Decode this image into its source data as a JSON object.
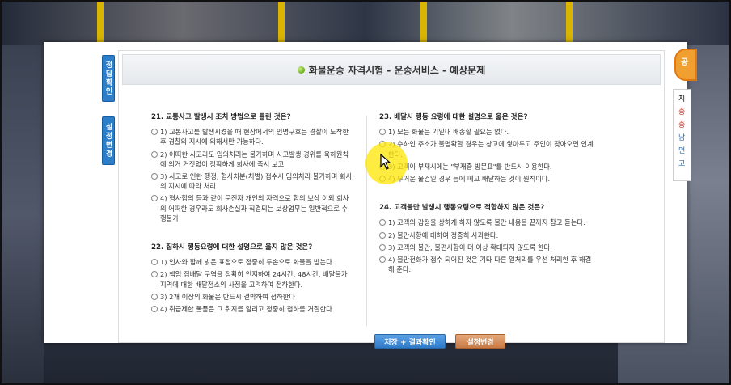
{
  "side_tabs": {
    "answer_check": "정답확인",
    "settings_change": "설정변경"
  },
  "header": {
    "title": "화물운송 자격시험 - 운송서비스 - 예상문제"
  },
  "questions_left": [
    {
      "title": "21. 교통사고 발생시 조치 방법으로 틀린 것은?",
      "options": [
        "1) 교통사고를 발생시켰을 때 현장에서의 인명구호는 경찰이 도착한 후 경찰의 지시에 의해서만 가능하다.",
        "2) 어떠한 사고라도 임의처리는 불가하며 사고발생 경위를 육하원칙에 의거 거짓없이 정확하게 회사에 즉시 보고",
        "3) 사고로 인한 행정, 형사처분(처벌) 접수시 임의처리 불가하며 회사의 지시에 따라 처리",
        "4) 형사합의 등과 같이 운전자 개인의 자격으로 합의 보상 이외 회사의 어떠한 경우라도 회사손실과 직결되는 보상업무는 일반적으로 수행불가"
      ]
    },
    {
      "title": "22. 집하시 행동요령에 대한 설명으로 옳지 않은 것은?",
      "options": [
        "1) 인사와 함께 밝은 표정으로 정중히 두손으로 화물을 받는다.",
        "2) 책임 집배달 구역을 정확히 인지하여 24시간, 48시간, 배달불가 지역에 대한 배달점소의 사정을 고려하여 접하한다.",
        "3) 2개 이상의 화물은 반드시 결박하여 접하한다",
        "4) 취급제한 물품은 그 취지를 알리고 정중히 접하를 거절한다."
      ]
    }
  ],
  "questions_right": [
    {
      "title": "23. 배달시 행동 요령에 대한 설명으로 옳은 것은?",
      "options": [
        "1) 모든 화물은 기일내 배송할 필요는 없다.",
        "2) 수하인 주소가 불명확할 경우는 창고에 쌓아두고 주인이 찾아오면 인계한다.",
        "3) 고객이 부재시에는 \"부재중 방문표\"를 반드시 이용한다.",
        "4) 무거운 물건일 경우 등에 메고 배달하는 것이 원칙이다."
      ]
    },
    {
      "title": "24. 고객불만 발생시 행동요령으로 적합하지 않은 것은?",
      "options": [
        "1) 고객의 감정을 상하게 하지 않도록 불만 내용을 끝까지 참고 듣는다.",
        "2) 불만사항에 대하여 정중히 사과한다.",
        "3) 고객의 불만, 불편사항이 더 이상 확대되지 않도록 한다.",
        "4) 불만전화가 접수 되어진 것은 기타 다른 일처리를 우선 처리한 후 해결해 준다."
      ]
    }
  ],
  "buttons": {
    "save_result": "저장 + 결과확인",
    "settings": "설정변경"
  },
  "right_widget": {
    "badge": "공",
    "items": [
      "지",
      "종",
      "종",
      "남",
      "면",
      "고"
    ]
  },
  "colors": {
    "accent_blue": "#2d7ec8",
    "button_orange": "#c77a45",
    "cursor_highlight": "#ffe600"
  },
  "icons": {
    "title_bullet": "green-dot-icon",
    "cursor": "mouse-pointer-icon"
  }
}
